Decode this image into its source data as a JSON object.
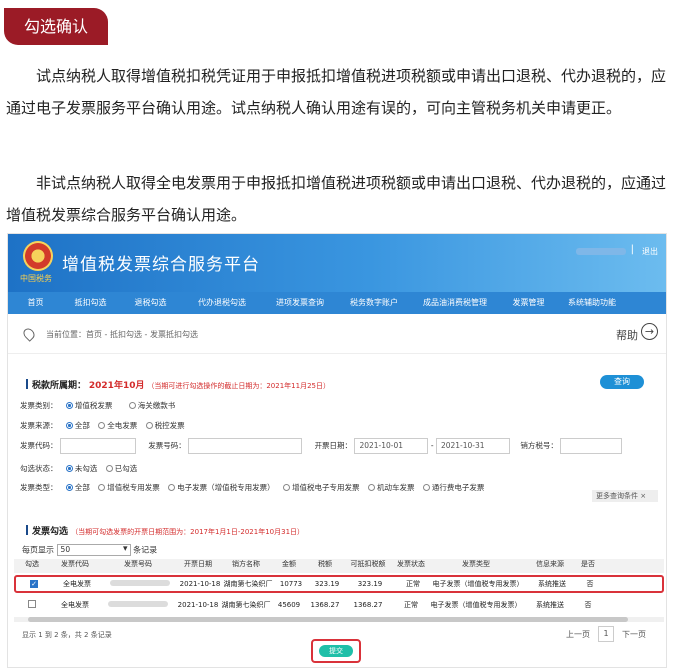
{
  "section_tag": "勾选确认",
  "paragraphs": [
    "试点纳税人取得增值税扣税凭证用于申报抵扣增值税进项税额或申请出口退税、代办退税的，应通过电子发票服务平台确认用途。试点纳税人确认用途有误的，可向主管税务机关申请更正。",
    "非试点纳税人取得全电发票用于申报抵扣增值税进项税额或申请出口退税、代办退税的，应通过增值税发票综合服务平台确认用途。"
  ],
  "platform": {
    "title": "增值税发票综合服务平台",
    "emblem_text": "中国税务",
    "separator": "|",
    "exit": "退出",
    "nav": [
      "首页",
      "抵扣勾选",
      "退税勾选",
      "代办退税勾选",
      "进项发票查询",
      "税务数字账户",
      "成品油消费税管理",
      "发票管理",
      "系统辅助功能"
    ],
    "breadcrumb": "当前位置：首页 - 抵扣勾选 - 发票抵扣勾选",
    "help": "帮助"
  },
  "filters": {
    "period_label": "税款所属期：",
    "period_value": "2021年10月",
    "period_note": "（当期可进行勾选操作的截止日期为：2021年11月25日）",
    "query_btn": "查询",
    "invoice_category_label": "发票类别：",
    "invoice_category_opts": [
      "增值税发票",
      "海关缴款书"
    ],
    "source_label": "发票来源：",
    "source_opts": [
      "全部",
      "全电发票",
      "税控发票"
    ],
    "code_label": "发票代码：",
    "number_label": "发票号码：",
    "date_label": "开票日期：",
    "date_from": "2021-10-01",
    "date_sep": "-",
    "date_to": "2021-10-31",
    "seller_tax_label": "销方税号：",
    "status_label": "勾选状态：",
    "status_opts": [
      "未勾选",
      "已勾选"
    ],
    "type_label": "发票类型：",
    "type_opts": [
      "全部",
      "增值税专用发票",
      "电子发票（增值税专用发票）",
      "增值税电子专用发票",
      "机动车发票",
      "通行费电子发票"
    ],
    "more": "更多查询条件 ×"
  },
  "table": {
    "title": "发票勾选",
    "note": "（当期可勾选发票的开票日期范围为：2017年1月1日-2021年10月31日）",
    "page_size_label": "每页显示",
    "page_size_value": "50",
    "page_size_unit": "条记录",
    "headers": [
      "勾选",
      "发票代码",
      "发票号码",
      "开票日期",
      "销方名称",
      "金额",
      "税额",
      "可抵扣税额",
      "发票状态",
      "发票类型",
      "信息来源",
      "是否"
    ],
    "rows": [
      {
        "checked": true,
        "code": "全电发票",
        "date": "2021-10-18",
        "seller": "湖南第七染织厂",
        "amount": "10773",
        "tax": "323.19",
        "deductible": "323.19",
        "status": "正常",
        "type": "电子发票（增值税专用发票）",
        "source": "系统推送",
        "extra": "否"
      },
      {
        "checked": false,
        "code": "全电发票",
        "date": "2021-10-18",
        "seller": "湖南第七染织厂",
        "amount": "45609",
        "tax": "1368.27",
        "deductible": "1368.27",
        "status": "正常",
        "type": "电子发票（增值税专用发票）",
        "source": "系统推送",
        "extra": "否"
      }
    ],
    "summary": "显示 1 到 2 条，共 2 条记录",
    "prev": "上一页",
    "page": "1",
    "next": "下一页",
    "submit": "提交"
  }
}
